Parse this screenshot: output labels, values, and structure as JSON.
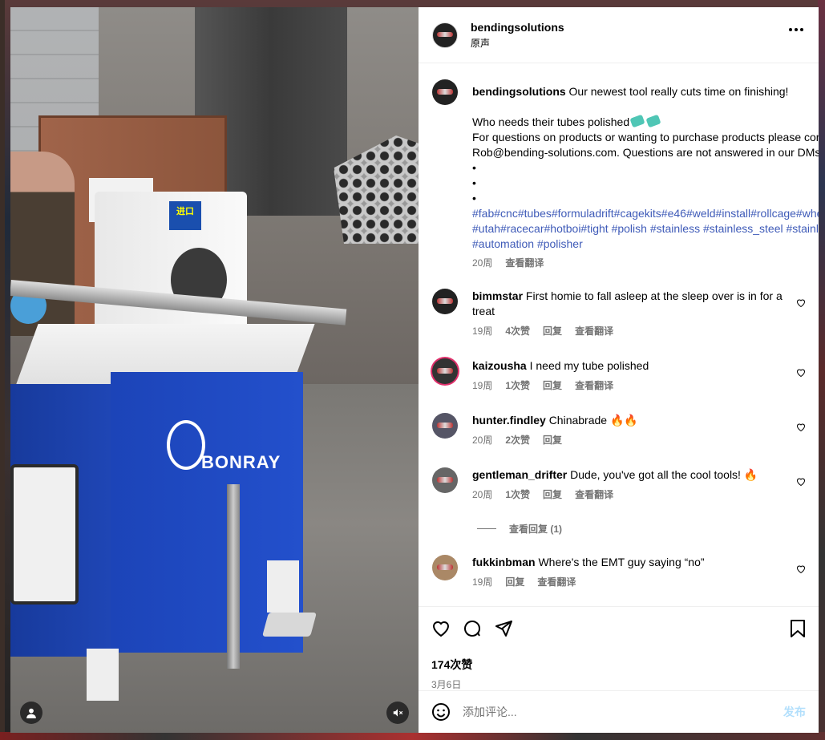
{
  "post": {
    "username": "bendingsolutions",
    "audio": "原声",
    "caption": {
      "username": "bendingsolutions",
      "first_line": "Our newest tool really cuts time on finishing!",
      "line2": "Who needs their tubes polished",
      "line3": "For questions on products or wanting to purchase products please contact Rob@bending-solutions.com. Questions are not answered in our DMs",
      "bullets": [
        "•",
        "•",
        "•"
      ],
      "hashtags_line1": "#fab#cnc#tubes#formuladrift#cagekits#e46#weld#install#rollcage#wheelchair#diy#local",
      "hashtags_line2": "#utah#racecar#hotboi#tight #polish #stainless #stainless_steel #stainlessteel #automation #polisher",
      "time": "20周",
      "translate": "查看翻译"
    },
    "likes": "174次赞",
    "date": "3月6日"
  },
  "comments": [
    {
      "username": "bimmstar",
      "text": "First homie to fall asleep at the sleep over is in for a treat",
      "time": "19周",
      "likes": "4次赞",
      "reply": "回复",
      "translate": "查看翻译"
    },
    {
      "username": "kaizousha",
      "text": "I need my tube polished",
      "time": "19周",
      "likes": "1次赞",
      "reply": "回复",
      "translate": "查看翻译"
    },
    {
      "username": "hunter.findley",
      "text": "Chinabrade 🔥🔥",
      "time": "20周",
      "likes": "2次赞",
      "reply": "回复"
    },
    {
      "username": "gentleman_drifter",
      "text": "Dude, you've got all the cool tools! 🔥",
      "time": "20周",
      "likes": "1次赞",
      "reply": "回复",
      "translate": "查看翻译",
      "view_replies": "查看回复 (1)"
    },
    {
      "username": "fukkinbman",
      "text": "Where's the EMT guy saying “no”",
      "time": "19周",
      "reply": "回复",
      "translate": "查看翻译"
    }
  ],
  "add_comment": {
    "placeholder": "添加评论...",
    "post_label": "发布"
  },
  "media": {
    "brand_text": "BONRAY",
    "sign_text": "进口"
  },
  "icons": {
    "header_more": "more-horizontal-icon",
    "like": "heart-icon",
    "comment": "comment-icon",
    "share": "send-icon",
    "save": "bookmark-icon",
    "emoji": "emoji-icon",
    "user_tag": "user-icon",
    "mute": "speaker-muted-icon"
  },
  "colors": {
    "hashtag": "#00376b",
    "muted_text": "#737373",
    "post_button": "#b2dffc"
  }
}
